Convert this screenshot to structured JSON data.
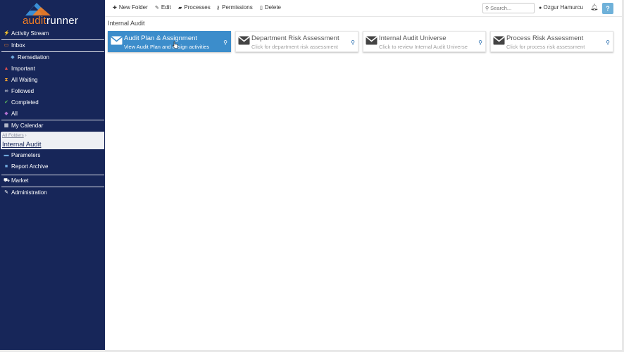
{
  "logo": {
    "text_a": "audit",
    "text_b": "runner"
  },
  "sidebar": {
    "items": [
      {
        "label": "Activity Stream",
        "icon": "bolt-icon"
      },
      {
        "label": "Inbox",
        "icon": "inbox-icon"
      },
      {
        "label": "Remediation",
        "icon": "tag-icon"
      },
      {
        "label": "Important",
        "icon": "warning-icon"
      },
      {
        "label": "All Waiting",
        "icon": "hourglass-icon"
      },
      {
        "label": "Followed",
        "icon": "binoculars-icon"
      },
      {
        "label": "Completed",
        "icon": "check-icon"
      },
      {
        "label": "All",
        "icon": "tag-icon"
      },
      {
        "label": "My Calendar",
        "icon": "calendar-icon"
      },
      {
        "label": "Parameters",
        "icon": "folder-icon"
      },
      {
        "label": "Report Archive",
        "icon": "archive-icon"
      },
      {
        "label": "Market",
        "icon": "cart-icon"
      },
      {
        "label": "Administration",
        "icon": "wrench-icon"
      }
    ],
    "folder_crumb": "All Folders",
    "folder_current": "Internal Audit"
  },
  "toolbar": {
    "new_folder": "New Folder",
    "edit": "Edit",
    "processes": "Processes",
    "permissions": "Permissions",
    "delete": "Delete",
    "search_placeholder": "Search...",
    "user": "Ozgur Hamurcu",
    "help": "?"
  },
  "page_title": "Internal Audit",
  "cards": [
    {
      "title": "Audit Plan & Assignment",
      "desc": "View Audit Plan and assign activities"
    },
    {
      "title": "Department Risk Assessment",
      "desc": "Click for department risk assessment"
    },
    {
      "title": "Internal Audit Universe",
      "desc": "Click to review Internal Audit Universe"
    },
    {
      "title": "Process Risk Assessment",
      "desc": "Click for process risk assessment"
    }
  ],
  "colors": {
    "sidebar_bg": "#172659",
    "accent": "#3c8dcb",
    "logo_orange": "#f47f24",
    "logo_blue": "#3a8fd6"
  }
}
